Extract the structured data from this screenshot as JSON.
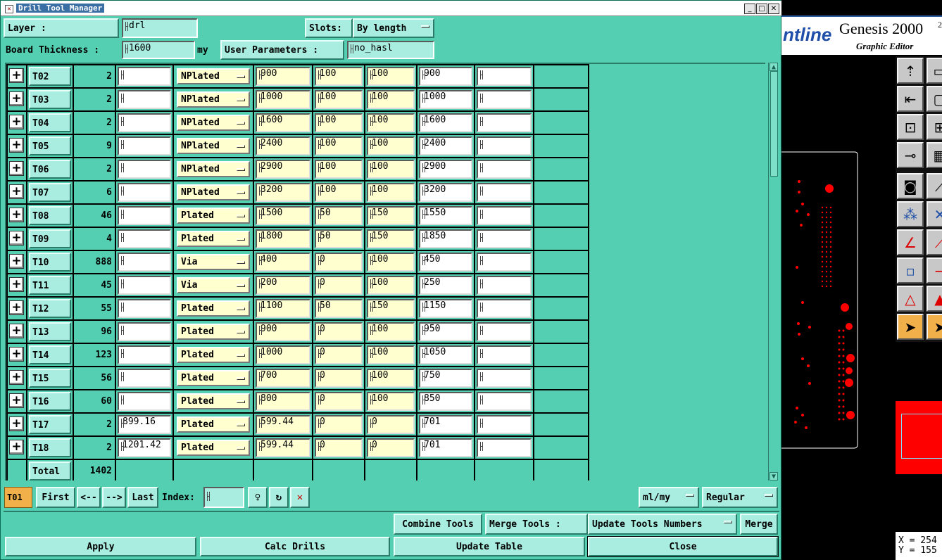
{
  "window": {
    "title": "Drill Tool Manager",
    "sys_icon": "x-icon"
  },
  "header": {
    "layer_label": "Layer        :",
    "layer_value": "drl",
    "slots_label": "Slots:",
    "slots_value": "By length",
    "thickness_label": "Board Thickness :",
    "thickness_value": "1600",
    "thickness_unit": "my",
    "user_params_label": "User Parameters :",
    "user_params_value": "no_hasl"
  },
  "rows": [
    {
      "tool": "T02",
      "count": "2",
      "finish": "",
      "type": "NPlated",
      "drill": "900",
      "tol_minus": "100",
      "tol_plus": "100",
      "finish2": "900",
      "extra": ""
    },
    {
      "tool": "T03",
      "count": "2",
      "finish": "",
      "type": "NPlated",
      "drill": "1000",
      "tol_minus": "100",
      "tol_plus": "100",
      "finish2": "1000",
      "extra": ""
    },
    {
      "tool": "T04",
      "count": "2",
      "finish": "",
      "type": "NPlated",
      "drill": "1600",
      "tol_minus": "100",
      "tol_plus": "100",
      "finish2": "1600",
      "extra": ""
    },
    {
      "tool": "T05",
      "count": "9",
      "finish": "",
      "type": "NPlated",
      "drill": "2400",
      "tol_minus": "100",
      "tol_plus": "100",
      "finish2": "2400",
      "extra": ""
    },
    {
      "tool": "T06",
      "count": "2",
      "finish": "",
      "type": "NPlated",
      "drill": "2900",
      "tol_minus": "100",
      "tol_plus": "100",
      "finish2": "2900",
      "extra": ""
    },
    {
      "tool": "T07",
      "count": "6",
      "finish": "",
      "type": "NPlated",
      "drill": "3200",
      "tol_minus": "100",
      "tol_plus": "100",
      "finish2": "3200",
      "extra": ""
    },
    {
      "tool": "T08",
      "count": "46",
      "finish": "",
      "type": "Plated",
      "drill": "1500",
      "tol_minus": "50",
      "tol_plus": "150",
      "finish2": "1550",
      "extra": ""
    },
    {
      "tool": "T09",
      "count": "4",
      "finish": "",
      "type": "Plated",
      "drill": "1800",
      "tol_minus": "50",
      "tol_plus": "150",
      "finish2": "1850",
      "extra": ""
    },
    {
      "tool": "T10",
      "count": "888",
      "finish": "",
      "type": "Via",
      "drill": "400",
      "tol_minus": "0",
      "tol_plus": "100",
      "finish2": "450",
      "extra": ""
    },
    {
      "tool": "T11",
      "count": "45",
      "finish": "",
      "type": "Via",
      "drill": "200",
      "tol_minus": "0",
      "tol_plus": "100",
      "finish2": "250",
      "extra": ""
    },
    {
      "tool": "T12",
      "count": "55",
      "finish": "",
      "type": "Plated",
      "drill": "1100",
      "tol_minus": "50",
      "tol_plus": "150",
      "finish2": "1150",
      "extra": ""
    },
    {
      "tool": "T13",
      "count": "96",
      "finish": "",
      "type": "Plated",
      "drill": "900",
      "tol_minus": "0",
      "tol_plus": "100",
      "finish2": "950",
      "extra": ""
    },
    {
      "tool": "T14",
      "count": "123",
      "finish": "",
      "type": "Plated",
      "drill": "1000",
      "tol_minus": "0",
      "tol_plus": "100",
      "finish2": "1050",
      "extra": ""
    },
    {
      "tool": "T15",
      "count": "56",
      "finish": "",
      "type": "Plated",
      "drill": "700",
      "tol_minus": "0",
      "tol_plus": "100",
      "finish2": "750",
      "extra": ""
    },
    {
      "tool": "T16",
      "count": "60",
      "finish": "",
      "type": "Plated",
      "drill": "800",
      "tol_minus": "0",
      "tol_plus": "100",
      "finish2": "850",
      "extra": ""
    },
    {
      "tool": "T17",
      "count": "2",
      "finish": "899.16",
      "type": "Plated",
      "drill": "599.44",
      "tol_minus": "0",
      "tol_plus": "0",
      "finish2": "701",
      "extra": ""
    },
    {
      "tool": "T18",
      "count": "2",
      "finish": "1201.42",
      "type": "Plated",
      "drill": "599.44",
      "tol_minus": "0",
      "tol_plus": "0",
      "finish2": "701",
      "extra": ""
    }
  ],
  "total": {
    "label": "Total",
    "value": "1402"
  },
  "nav": {
    "current_tool": "T01",
    "first": "First",
    "prev": "<--",
    "next": "-->",
    "last": "Last",
    "index_label": "Index:",
    "units": "ml/my",
    "mode": "Regular"
  },
  "actions": {
    "combine": "Combine Tools",
    "merge_label": "Merge Tools :",
    "update_numbers": "Update Tools Numbers",
    "merge": "Merge",
    "apply": "Apply",
    "calc": "Calc Drills",
    "update_table": "Update Table",
    "close": "Close"
  },
  "genesis": {
    "brand_partial": "ntline",
    "title": "Genesis 2000",
    "title_sup": "2",
    "subtitle": "Graphic Editor",
    "coord_x": "X = 254",
    "coord_y": "Y = 155"
  },
  "colors": {
    "panel": "#55cfb2",
    "button": "#a8ede0",
    "field_yellow": "#ffffd0",
    "pad_red": "#ff0000"
  }
}
